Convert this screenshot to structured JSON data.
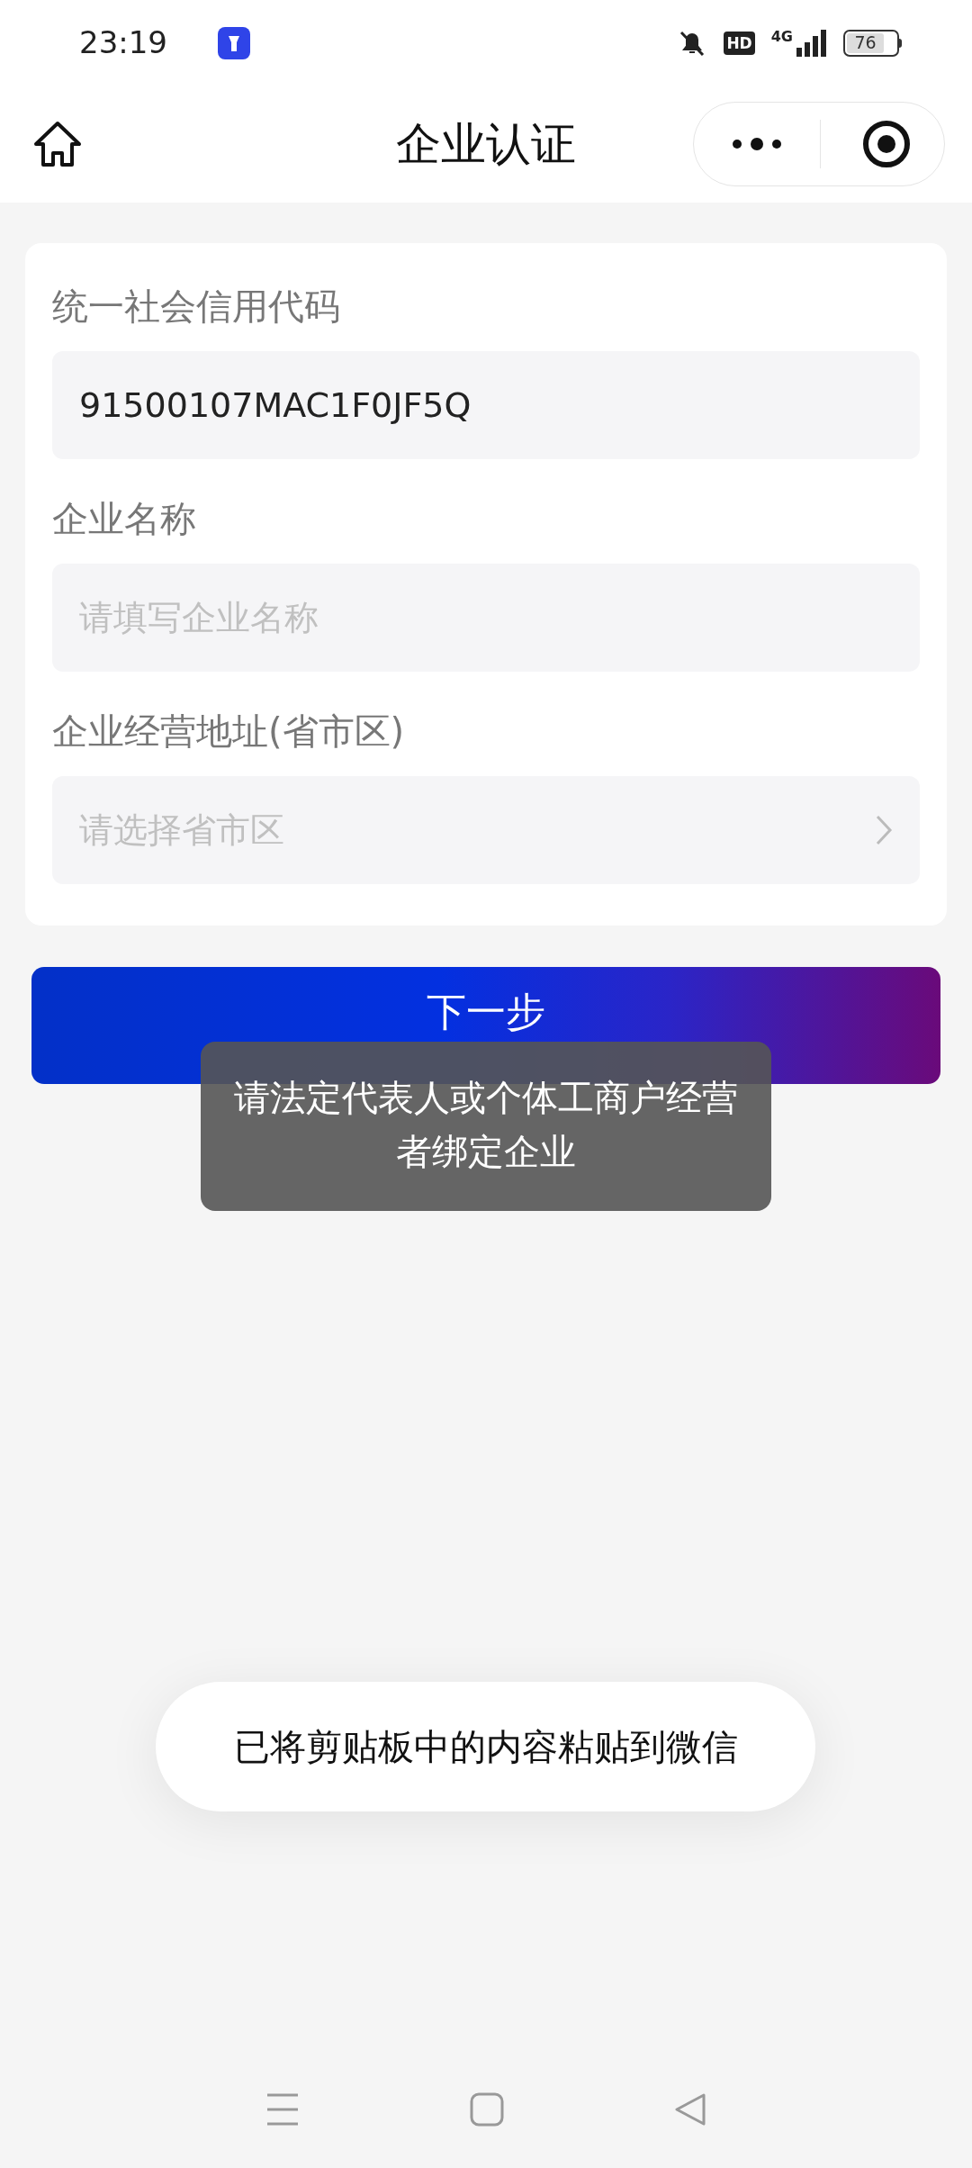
{
  "status_bar": {
    "time": "23:19",
    "battery": "76",
    "network": "4G",
    "hd": "HD"
  },
  "header": {
    "title": "企业认证"
  },
  "form": {
    "fields": [
      {
        "kind": "input",
        "label": "统一社会信用代码",
        "value": "91500107MAC1F0JF5Q"
      },
      {
        "kind": "input",
        "label": "企业名称",
        "placeholder": "请填写企业名称"
      },
      {
        "kind": "select",
        "label": "企业经营地址(省市区)",
        "placeholder": "请选择省市区"
      }
    ]
  },
  "next_button": {
    "label": "下一步"
  },
  "toast": {
    "message": "请法定代表人或个体工商户经营者绑定企业"
  },
  "clipboard_notice": {
    "message": "已将剪贴板中的内容粘贴到微信"
  }
}
